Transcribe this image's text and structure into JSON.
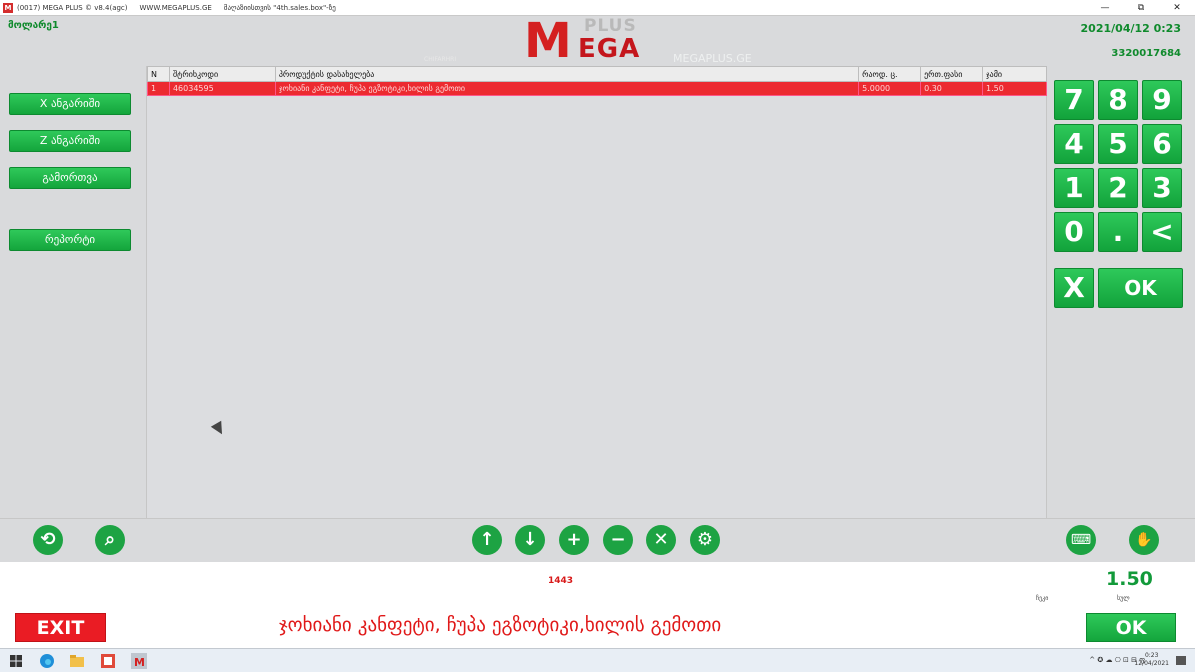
{
  "titlebar": {
    "app_title": "(0017) MEGA PLUS  ©  v8.4(agc)",
    "site": "WWW.MEGAPLUS.GE",
    "extra": "მაღაზიისთვის \"4th.sales.box\"-ზე",
    "minimize": "—",
    "restore": "⧉",
    "close": "✕"
  },
  "header": {
    "user": "მოლარე1",
    "logo_main": "M",
    "logo_plus": "PLUS",
    "logo_ega": "EGA",
    "site": "MEGAPLUS.GE",
    "subtle": "CHIFARHRI",
    "date": "2021/04/12 0:23",
    "code": "3320017684"
  },
  "left_menu": [
    "X ანგარიში",
    "Z ანგარიში",
    "გამორთვა",
    "რეპორტი"
  ],
  "grid": {
    "columns": [
      "N",
      "შტრიხკოდი",
      "პროდუქტის დასახელება",
      "რაოდ. ც.",
      "ერთ.ფასი",
      "ჯამი"
    ],
    "rows": [
      [
        "1",
        "46034595",
        "ჯოხიანი კანფეტი, ჩუპა ეგზოტიკი,ხილის გემოთი",
        "5.0000",
        "0.30",
        "1.50"
      ]
    ]
  },
  "keypad": {
    "keys": [
      "7",
      "8",
      "9",
      "4",
      "5",
      "6",
      "1",
      "2",
      "3",
      "0",
      ".",
      "<"
    ],
    "cancel": "X",
    "ok": "OK"
  },
  "toolbar": {
    "icons": [
      "sync-icon",
      "search-icon",
      "arrow-up-icon",
      "arrow-down-icon",
      "plus-icon",
      "minus-icon",
      "delete-icon",
      "settings-icon",
      "keyboard-icon",
      "hand-icon"
    ]
  },
  "bottom": {
    "count": "1443",
    "total": "1.50",
    "label_left": "ჩეკი",
    "label_right": "სულ",
    "exit": "EXIT",
    "product_name": "ჯოხიანი კანფეტი, ჩუპა ეგზოტიკი,ხილის გემოთი",
    "ok": "OK"
  },
  "taskbar": {
    "time": "0:23",
    "date": "12/04/2021",
    "tray": "^ ✪ ☁ ⎔ ⊡ ⊟ ფ"
  }
}
